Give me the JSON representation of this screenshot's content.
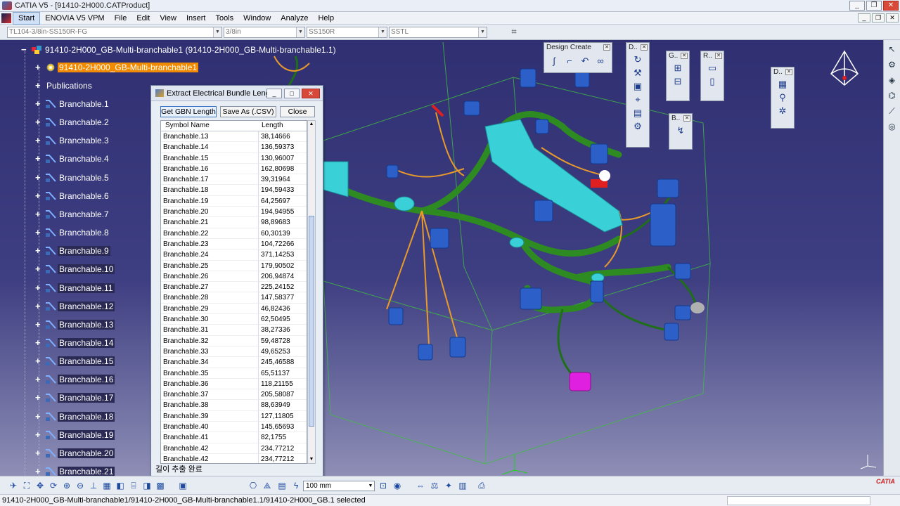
{
  "window": {
    "title": "CATIA V5 - [91410-2H000.CATProduct]",
    "buttons": [
      "_",
      "❐",
      "✕"
    ]
  },
  "menu": {
    "items": [
      "Start",
      "ENOVIA V5 VPM",
      "File",
      "Edit",
      "View",
      "Insert",
      "Tools",
      "Window",
      "Analyze",
      "Help"
    ],
    "mdi_buttons": [
      "_",
      "❐",
      "✕"
    ]
  },
  "combos": {
    "bundle": "TL104-3/8in-SS150R-FG",
    "size": "3/8in",
    "material": "SS150R",
    "type": "SSTL"
  },
  "tree": {
    "root": "91410-2H000_GB-Multi-branchable1 (91410-2H000_GB-Multi-branchable1.1)",
    "active": "91410-2H000_GB-Multi-branchable1",
    "publications": "Publications",
    "branchables": [
      "Branchable.1",
      "Branchable.2",
      "Branchable.3",
      "Branchable.4",
      "Branchable.5",
      "Branchable.6",
      "Branchable.7",
      "Branchable.8",
      "Branchable.9",
      "Branchable.10",
      "Branchable.11",
      "Branchable.12",
      "Branchable.13",
      "Branchable.14",
      "Branchable.15",
      "Branchable.16",
      "Branchable.17",
      "Branchable.18",
      "Branchable.19",
      "Branchable.20",
      "Branchable.21"
    ]
  },
  "toolbars": {
    "design_create": {
      "title": "Design Create",
      "icons": [
        "curve-icon",
        "spline-icon",
        "bend-icon",
        "loop-icon",
        "flatten-icon"
      ]
    },
    "d1": {
      "title": "D..",
      "icons": [
        "rotate-icon",
        "tool-icon",
        "part-icon",
        "sketch-icon",
        "table-icon",
        "gear-icon"
      ]
    },
    "g": {
      "title": "G..",
      "icons": [
        "connector-icon",
        "clip-icon"
      ]
    },
    "r": {
      "title": "R..",
      "icons": [
        "doc-icon",
        "doc2-icon"
      ]
    },
    "b": {
      "title": "B..",
      "icons": [
        "route-icon"
      ]
    },
    "d2": {
      "title": "D..",
      "icons": [
        "bundle-icon",
        "scope-icon",
        "cog-icon"
      ]
    }
  },
  "dialog": {
    "title": "Extract Electrical Bundle Length",
    "btn_get": "Get GBN Length",
    "btn_save": "Save As (.CSV)",
    "btn_close": "Close",
    "col_name": "Symbol Name",
    "col_length": "Length",
    "rows": [
      {
        "name": "Branchable.13",
        "length": "38,14666"
      },
      {
        "name": "Branchable.14",
        "length": "136,59373"
      },
      {
        "name": "Branchable.15",
        "length": "130,96007"
      },
      {
        "name": "Branchable.16",
        "length": "162,80698"
      },
      {
        "name": "Branchable.17",
        "length": "39,31964"
      },
      {
        "name": "Branchable.18",
        "length": "194,59433"
      },
      {
        "name": "Branchable.19",
        "length": "64,25697"
      },
      {
        "name": "Branchable.20",
        "length": "194,94955"
      },
      {
        "name": "Branchable.21",
        "length": "98,89683"
      },
      {
        "name": "Branchable.22",
        "length": "60,30139"
      },
      {
        "name": "Branchable.23",
        "length": "104,72266"
      },
      {
        "name": "Branchable.24",
        "length": "371,14253"
      },
      {
        "name": "Branchable.25",
        "length": "179,90502"
      },
      {
        "name": "Branchable.26",
        "length": "206,94874"
      },
      {
        "name": "Branchable.27",
        "length": "225,24152"
      },
      {
        "name": "Branchable.28",
        "length": "147,58377"
      },
      {
        "name": "Branchable.29",
        "length": "46,82436"
      },
      {
        "name": "Branchable.30",
        "length": "62,50495"
      },
      {
        "name": "Branchable.31",
        "length": "38,27336"
      },
      {
        "name": "Branchable.32",
        "length": "59,48728"
      },
      {
        "name": "Branchable.33",
        "length": "49,65253"
      },
      {
        "name": "Branchable.34",
        "length": "245,46588"
      },
      {
        "name": "Branchable.35",
        "length": "65,51137"
      },
      {
        "name": "Branchable.36",
        "length": "118,21155"
      },
      {
        "name": "Branchable.37",
        "length": "205,58087"
      },
      {
        "name": "Branchable.38",
        "length": "88,63949"
      },
      {
        "name": "Branchable.39",
        "length": "127,11805"
      },
      {
        "name": "Branchable.40",
        "length": "145,65693"
      },
      {
        "name": "Branchable.41",
        "length": "82,1755"
      },
      {
        "name": "Branchable.42",
        "length": "234,77212"
      },
      {
        "name": "Branchable.42",
        "length": "234,77212"
      }
    ],
    "status": "길이 추출 완료"
  },
  "bottom": {
    "zoom": "100 mm",
    "logo": "CATIA"
  },
  "status": "91410-2H000_GB-Multi-branchable1/91410-2H000_GB-Multi-branchable1.1/91410-2H000_GB.1 selected",
  "colors": {
    "viewport_top": "#2f2f72",
    "viewport_bottom": "#8e8eb6",
    "wire": "#2e8b22",
    "wire_orange": "#e89a2a",
    "part_cyan": "#3ad0d8",
    "connector_blue": "#2d5fc8",
    "highlight": "#f08a00"
  }
}
